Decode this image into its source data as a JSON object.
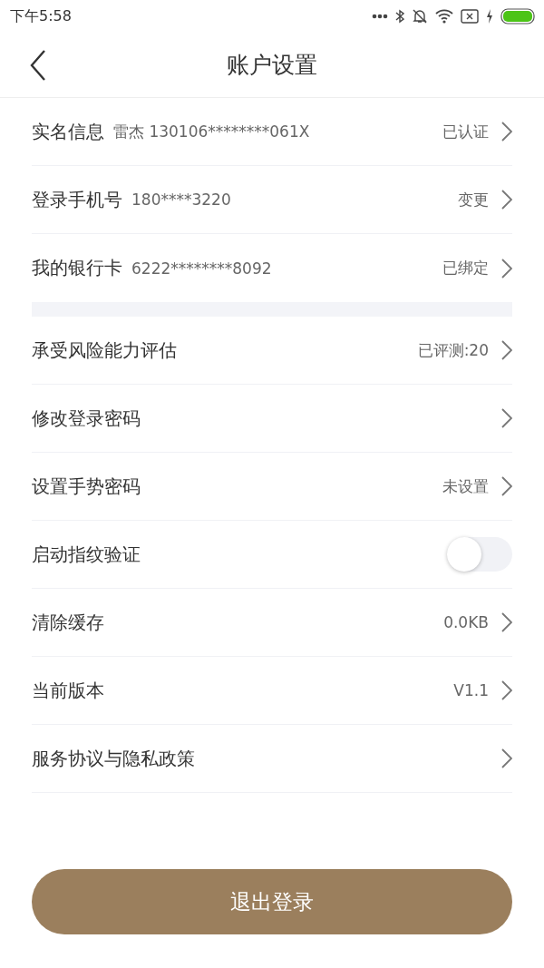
{
  "status_bar": {
    "time": "下午5:58"
  },
  "header": {
    "title": "账户设置"
  },
  "groups": [
    {
      "items": [
        {
          "kind": "link",
          "label": "实名信息",
          "detail": "雷杰 130106********061X",
          "value": "已认证"
        },
        {
          "kind": "link",
          "label": "登录手机号",
          "detail": "180****3220",
          "value": "变更"
        },
        {
          "kind": "link",
          "label": "我的银行卡",
          "detail": "6222********8092",
          "value": "已绑定"
        }
      ]
    },
    {
      "items": [
        {
          "kind": "link",
          "label": "承受风险能力评估",
          "value": "已评测:20"
        },
        {
          "kind": "link",
          "label": "修改登录密码"
        },
        {
          "kind": "link",
          "label": "设置手势密码",
          "value": "未设置"
        },
        {
          "kind": "toggle",
          "label": "启动指纹验证",
          "on": false
        },
        {
          "kind": "link",
          "label": "清除缓存",
          "value": "0.0KB"
        },
        {
          "kind": "link",
          "label": "当前版本",
          "value": "V1.1"
        },
        {
          "kind": "link",
          "label": "服务协议与隐私政策"
        }
      ]
    }
  ],
  "logout_button": {
    "label": "退出登录"
  }
}
